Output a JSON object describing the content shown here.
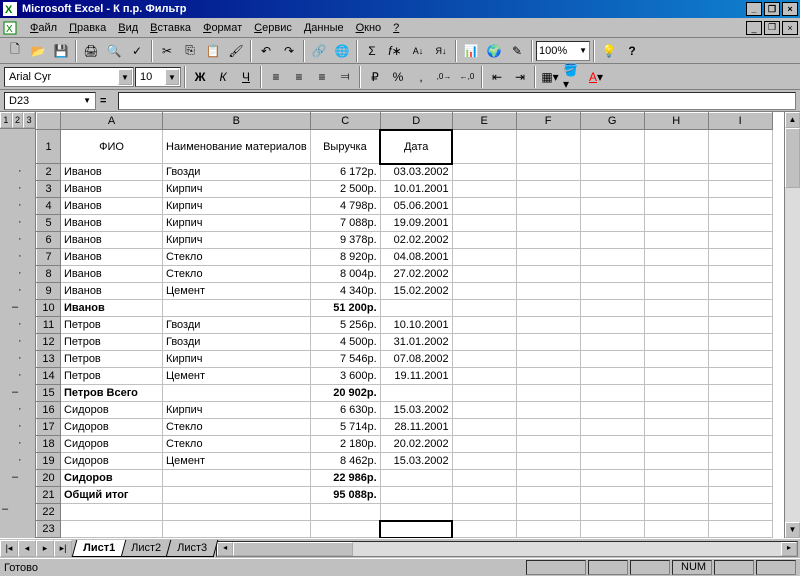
{
  "app": {
    "title": "Microsoft Excel - К п.р. Фильтр"
  },
  "menu": [
    "Файл",
    "Правка",
    "Вид",
    "Вставка",
    "Формат",
    "Сервис",
    "Данные",
    "Окно",
    "?"
  ],
  "zoom": "100%",
  "font": {
    "name": "Arial Cyr",
    "size": "10"
  },
  "namebox": "D23",
  "formula": "",
  "outline_levels": [
    "1",
    "2",
    "3"
  ],
  "columns": [
    "A",
    "B",
    "C",
    "D",
    "E",
    "F",
    "G",
    "H",
    "I"
  ],
  "headers": {
    "A": "ФИО",
    "B": "Наименование материалов",
    "C": "Выручка",
    "D": "Дата"
  },
  "rows": [
    {
      "n": "2",
      "a": "Иванов",
      "b": "Гвозди",
      "c": "6 172р.",
      "d": "03.03.2002",
      "m": "·"
    },
    {
      "n": "3",
      "a": "Иванов",
      "b": "Кирпич",
      "c": "2 500р.",
      "d": "10.01.2001",
      "m": "·"
    },
    {
      "n": "4",
      "a": "Иванов",
      "b": "Кирпич",
      "c": "4 798р.",
      "d": "05.06.2001",
      "m": "·"
    },
    {
      "n": "5",
      "a": "Иванов",
      "b": "Кирпич",
      "c": "7 088р.",
      "d": "19.09.2001",
      "m": "·"
    },
    {
      "n": "6",
      "a": "Иванов",
      "b": "Кирпич",
      "c": "9 378р.",
      "d": "02.02.2002",
      "m": "·"
    },
    {
      "n": "7",
      "a": "Иванов",
      "b": "Стекло",
      "c": "8 920р.",
      "d": "04.08.2001",
      "m": "·"
    },
    {
      "n": "8",
      "a": "Иванов",
      "b": "Стекло",
      "c": "8 004р.",
      "d": "27.02.2002",
      "m": "·"
    },
    {
      "n": "9",
      "a": "Иванов",
      "b": "Цемент",
      "c": "4 340р.",
      "d": "15.02.2002",
      "m": "·"
    },
    {
      "n": "10",
      "a": "Иванов",
      "b": "",
      "c": "51 200р.",
      "d": "",
      "m": "–",
      "bold": true
    },
    {
      "n": "11",
      "a": "Петров",
      "b": "Гвозди",
      "c": "5 256р.",
      "d": "10.10.2001",
      "m": "·"
    },
    {
      "n": "12",
      "a": "Петров",
      "b": "Гвозди",
      "c": "4 500р.",
      "d": "31.01.2002",
      "m": "·"
    },
    {
      "n": "13",
      "a": "Петров",
      "b": "Кирпич",
      "c": "7 546р.",
      "d": "07.08.2002",
      "m": "·"
    },
    {
      "n": "14",
      "a": "Петров",
      "b": "Цемент",
      "c": "3 600р.",
      "d": "19.11.2001",
      "m": "·"
    },
    {
      "n": "15",
      "a": "Петров Всего",
      "b": "",
      "c": "20 902р.",
      "d": "",
      "m": "–",
      "bold": true
    },
    {
      "n": "16",
      "a": "Сидоров",
      "b": "Кирпич",
      "c": "6 630р.",
      "d": "15.03.2002",
      "m": "·"
    },
    {
      "n": "17",
      "a": "Сидоров",
      "b": "Стекло",
      "c": "5 714р.",
      "d": "28.11.2001",
      "m": "·"
    },
    {
      "n": "18",
      "a": "Сидоров",
      "b": "Стекло",
      "c": "2 180р.",
      "d": "20.02.2002",
      "m": "·"
    },
    {
      "n": "19",
      "a": "Сидоров",
      "b": "Цемент",
      "c": "8 462р.",
      "d": "15.03.2002",
      "m": "·"
    },
    {
      "n": "20",
      "a": "Сидоров",
      "b": "",
      "c": "22 986р.",
      "d": "",
      "m": "–",
      "bold": true
    },
    {
      "n": "21",
      "a": "Общий итог",
      "b": "",
      "c": "95 088р.",
      "d": "",
      "m": "",
      "bold": true
    },
    {
      "n": "22",
      "a": "",
      "b": "",
      "c": "",
      "d": "",
      "m": ""
    },
    {
      "n": "23",
      "a": "",
      "b": "",
      "c": "",
      "d": "",
      "m": "",
      "cursor": true
    }
  ],
  "sheets": [
    "Лист1",
    "Лист2",
    "Лист3"
  ],
  "active_sheet": 0,
  "status": "Готово",
  "indicators": {
    "num": "NUM"
  }
}
